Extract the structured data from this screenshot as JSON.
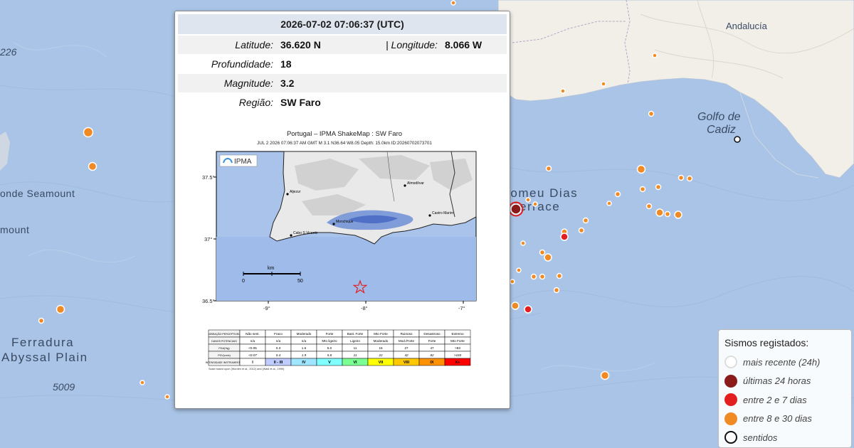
{
  "map": {
    "labels": {
      "andalucia": "Andalucía",
      "golfo_line1": "Golfo de",
      "golfo_line2": "Cadiz",
      "bartolomeu_line1": "Bartolomeu Dias",
      "bartolomeu_line2": "Terrace",
      "seamount1": "onde Seamount",
      "seamount2": "mount",
      "ferradura_line1": "Ferradura",
      "ferradura_line2": "Abyssal Plain",
      "depth_5009": "5009",
      "depth_226": "226"
    },
    "colors": {
      "sea": "#a9c4e6",
      "land": "#f2efe9",
      "quake_recent": "#ffffff",
      "quake_24h": "#8b1a1a",
      "quake_2_7": "#e31e1e",
      "quake_8_30": "#f08a24",
      "felt_ring": "#111111"
    }
  },
  "popup": {
    "datetime": "2026-07-02 07:06:37 (UTC)",
    "latitude_label": "Latitude:",
    "latitude_value": "36.620 N",
    "longitude_label": "| Longitude:",
    "longitude_value": "8.066 W",
    "depth_label": "Profundidade:",
    "depth_value": "18",
    "magnitude_label": "Magnitude:",
    "magnitude_value": "3.2",
    "region_label": "Região:",
    "region_value": "SW Faro"
  },
  "shakemap": {
    "title": "Portugal – IPMA ShakeMap : SW Faro",
    "subtitle": "JUL 2 2026 07:06:37 AM GMT   M 3.1   N36.64 W8.05   Depth: 15.0km   ID:20260702073701",
    "logo": "IPMA",
    "y_ticks": [
      "37.5°",
      "37°",
      "36.5°"
    ],
    "x_ticks": [
      "-9°",
      "-8°",
      "-7°"
    ],
    "scale_label": "km",
    "scale_ticks": [
      "0",
      "50"
    ],
    "towns": [
      "Aljezur",
      "Almodôvar",
      "Monchique",
      "Cabo S.Vicente",
      "Castro Marim"
    ],
    "table": {
      "row_headers": [
        "VIBRAÇÃO PERCEPTIVEL",
        "DANOS POTENCIAIS",
        "PGA(%g)",
        "PGV(cm/s)",
        "INTENSIDADE INSTRUMENTAL"
      ],
      "columns": [
        {
          "shaking": "Não sent.",
          "damage": "n/a",
          "pga": "<0.05",
          "pgv": "<0.07",
          "intensity": "I",
          "color": "#ffffff"
        },
        {
          "shaking": "Fraco",
          "damage": "n/a",
          "pga": "0.3",
          "pgv": "0.4",
          "intensity": "II - III",
          "color": "#bfccff"
        },
        {
          "shaking": "Moderado",
          "damage": "n/a",
          "pga": "1.6",
          "pgv": "1.9",
          "intensity": "IV",
          "color": "#a0e6ff"
        },
        {
          "shaking": "Forte",
          "damage": "Mto ligeiro",
          "pga": "5.0",
          "pgv": "5.8",
          "intensity": "V",
          "color": "#80ffff"
        },
        {
          "shaking": "Bast. Forte",
          "damage": "Ligeiro",
          "pga": "11",
          "pgv": "11",
          "intensity": "VI",
          "color": "#7aff93"
        },
        {
          "shaking": "Mto Forte",
          "damage": "Moderado",
          "pga": "15",
          "pgv": "22",
          "intensity": "VII",
          "color": "#ffff00"
        },
        {
          "shaking": "Ruinoso",
          "damage": "Mod./Forte",
          "pga": "27",
          "pgv": "42",
          "intensity": "VIII",
          "color": "#ffc800"
        },
        {
          "shaking": "Desastroso",
          "damage": "Forte",
          "pga": "47",
          "pgv": "82",
          "intensity": "IX",
          "color": "#ff9100"
        },
        {
          "shaking": "Extremo",
          "damage": "Mto Forte",
          "pga": ">83",
          "pgv": ">160",
          "intensity": "X+",
          "color": "#ff0000"
        }
      ],
      "footnote": "Scale based upon (Worden et al., 2012) and (Wald et al., 1999)"
    }
  },
  "legend": {
    "title": "Sismos registados:",
    "items": [
      {
        "label": "mais recente (24h)",
        "color": "#ffffff",
        "ring": "#dddddd"
      },
      {
        "label": "últimas 24 horas",
        "color": "#8b1a1a",
        "ring": "#8b1a1a"
      },
      {
        "label": "entre 2 e 7 dias",
        "color": "#e31e1e",
        "ring": "#e31e1e"
      },
      {
        "label": "entre 8 e 30 dias",
        "color": "#f08a24",
        "ring": "#f08a24"
      },
      {
        "label": "sentidos",
        "color": "#ffffff",
        "ring": "#111111"
      }
    ]
  }
}
